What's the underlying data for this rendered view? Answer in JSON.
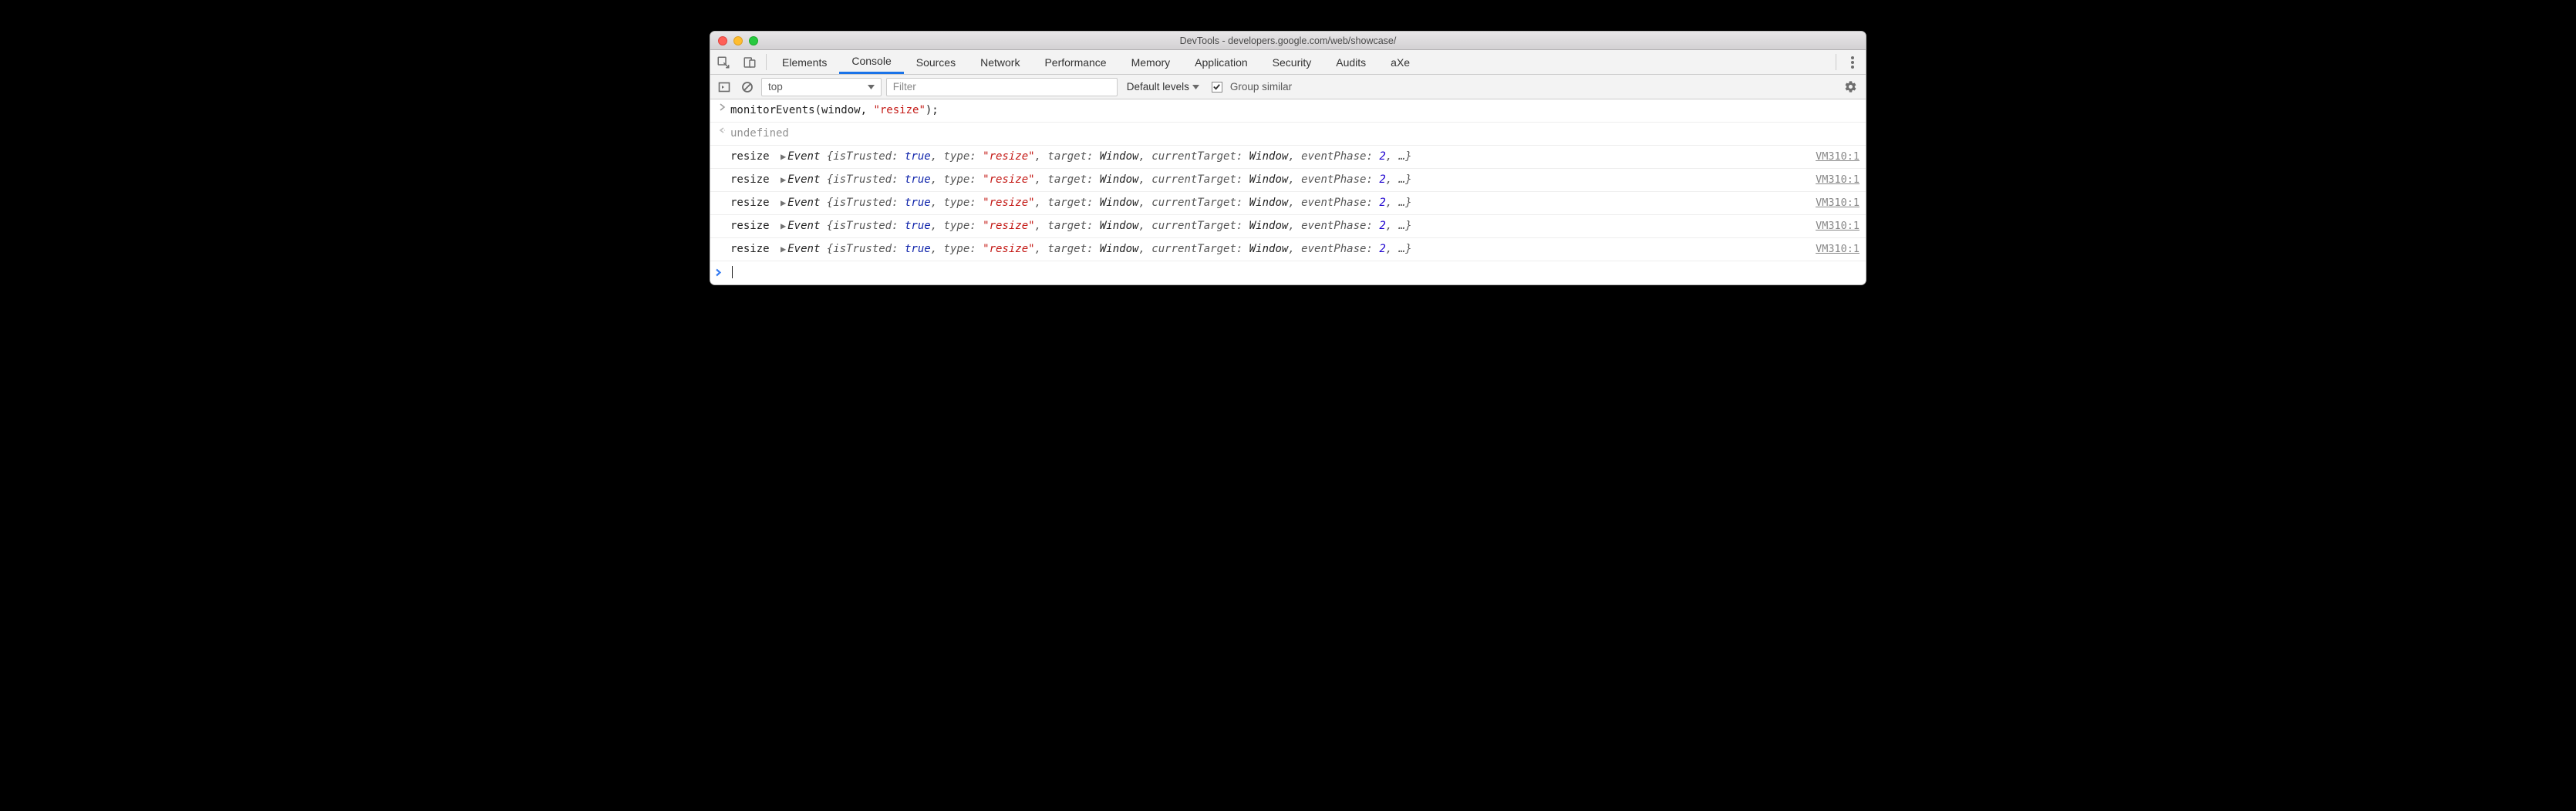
{
  "window": {
    "title": "DevTools - developers.google.com/web/showcase/"
  },
  "tabs": {
    "items": [
      "Elements",
      "Console",
      "Sources",
      "Network",
      "Performance",
      "Memory",
      "Application",
      "Security",
      "Audits",
      "aXe"
    ],
    "active": "Console"
  },
  "toolbar": {
    "context": "top",
    "filter_placeholder": "Filter",
    "levels_label": "Default levels",
    "group_similar_label": "Group similar",
    "group_similar_checked": true
  },
  "console": {
    "input_line": "monitorEvents(window, \"resize\");",
    "return_value": "undefined",
    "events": [
      {
        "label": "resize",
        "source": "VM310:1",
        "object": "Event",
        "props": {
          "isTrusted": "true",
          "type": "\"resize\"",
          "target": "Window",
          "currentTarget": "Window",
          "eventPhase": "2"
        }
      },
      {
        "label": "resize",
        "source": "VM310:1",
        "object": "Event",
        "props": {
          "isTrusted": "true",
          "type": "\"resize\"",
          "target": "Window",
          "currentTarget": "Window",
          "eventPhase": "2"
        }
      },
      {
        "label": "resize",
        "source": "VM310:1",
        "object": "Event",
        "props": {
          "isTrusted": "true",
          "type": "\"resize\"",
          "target": "Window",
          "currentTarget": "Window",
          "eventPhase": "2"
        }
      },
      {
        "label": "resize",
        "source": "VM310:1",
        "object": "Event",
        "props": {
          "isTrusted": "true",
          "type": "\"resize\"",
          "target": "Window",
          "currentTarget": "Window",
          "eventPhase": "2"
        }
      },
      {
        "label": "resize",
        "source": "VM310:1",
        "object": "Event",
        "props": {
          "isTrusted": "true",
          "type": "\"resize\"",
          "target": "Window",
          "currentTarget": "Window",
          "eventPhase": "2"
        }
      }
    ]
  }
}
